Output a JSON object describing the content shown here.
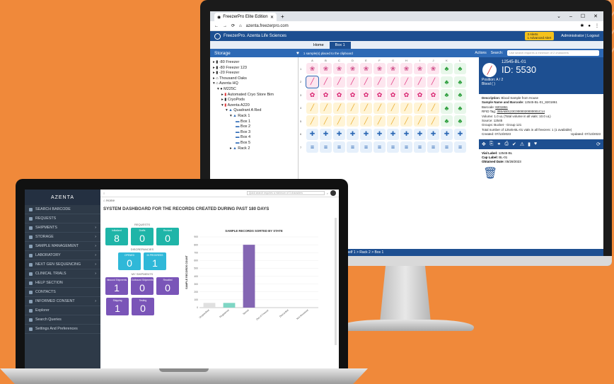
{
  "monitor": {
    "browser_tab": "FreezerPro Elite Edition",
    "url": "azenta.freezerpro.com",
    "app_title": "FreezerPro. Azenta Life Sciences",
    "alerts": [
      "3 Alerts",
      "1 Advanced Alert"
    ],
    "admin": "Administrator | Logout",
    "tabs": [
      "Home",
      "Box 1"
    ],
    "storage_label": "Storage",
    "clipboard_msg": "1 sample(s) placed to the clipboard",
    "actions_label": "Actions",
    "search_label": "Search:",
    "search_placeholder": "Use search requires a minimum of 2 characters",
    "tree": [
      "-80 Freezer",
      "-80 Freezer 123",
      "-20 Freezer",
      "Thousand Oaks",
      "Azenta HQ",
      "M225C",
      "Automated Cryo Store Bim",
      "CryoPods",
      "Azenta A220",
      "Quadrant A Red",
      "Rack 1",
      "Box 1",
      "Box 2",
      "Box 3",
      "Box 4",
      "Box 5",
      "Rack 2"
    ],
    "grid_cols": [
      "A",
      "B",
      "C",
      "D",
      "E",
      "F",
      "G",
      "H",
      "I",
      "J",
      "K",
      "L"
    ],
    "grid_rows": [
      "1",
      "2",
      "3",
      "4",
      "5",
      "6",
      "7"
    ],
    "detail": {
      "code": "12545-BL-01",
      "id": "ID: 5530",
      "position": "Position: A / 2",
      "type": "Blood ( )",
      "description": "Blood Sample from House",
      "sample_barcode": "12545-BL-01_8201861",
      "barcode": "8201861",
      "rfid": "355AB0123C0000020000001C14",
      "volume": "Volume: 1.0 uL (Total volume in all vials: 10.0 uL)",
      "source": "Source: 12545",
      "groups": "Groups: Bucket - Group 121",
      "total": "Total number of 12545-BL-01 vials in all freezers: 1 (1 available)",
      "created": "Created: 07/13/2023",
      "updated": "Updated: 07/13/2023",
      "vial_label": "12545-BL",
      "cap_label": "BL-01",
      "obtained": "05/28/2023"
    },
    "footer_breadcrumb": "Shelf 1 > Rack 2 > Box 1"
  },
  "laptop": {
    "brand": "AZENTA",
    "search_placeholder": "Quick search requires a minimum of 3 characters",
    "breadcrumb": "Home",
    "title": "SYSTEM DASHBOARD FOR THE RECORDS CREATED DURING PAST 180 DAYS",
    "nav": [
      "SEARCH BARCODE",
      "REQUESTS",
      "SHIPMENTS",
      "STORAGE",
      "SAMPLE MANAGEMENT",
      "LABORATORY",
      "NEXT GEN SEQUENCING",
      "CLINICAL TRIALS",
      "HELP SECTION",
      "CONTACTS",
      "INFORMED CONSENT",
      "Explorer",
      "Search Queries",
      "Settings And Preferences"
    ],
    "requests_label": "REQUESTS",
    "requests": [
      {
        "label": "Initialized",
        "value": "8",
        "color": "#1fb5a8"
      },
      {
        "label": "Drafts",
        "value": "0",
        "color": "#1fb5a8"
      },
      {
        "label": "Recived",
        "value": "0",
        "color": "#1fb5a8"
      }
    ],
    "discrepancies_label": "DISCREPANCIES",
    "discrepancies": [
      {
        "label": "OPENED",
        "value": "0",
        "color": "#2fb8d8"
      },
      {
        "label": "IN PROGRESS",
        "value": "1",
        "color": "#2fb8d8"
      }
    ],
    "shipments_label": "MY SHIPMENTS",
    "shipments": [
      {
        "label": "Inbound Shipments",
        "value": "1",
        "color": "#7a55b8"
      },
      {
        "label": "Outbound Shipments",
        "value": "0",
        "color": "#7a55b8"
      },
      {
        "label": "Recalled",
        "value": "0",
        "color": "#7a55b8"
      }
    ],
    "shipments2": [
      {
        "label": "Shipping",
        "value": "1",
        "color": "#7a55b8"
      },
      {
        "label": "Testing",
        "value": "0",
        "color": "#7a55b8"
      }
    ]
  },
  "chart_data": {
    "type": "bar",
    "title": "SAMPLE RECORDS SORTED BY STATE",
    "ylabel": "SAMPLE RECORDS COUNT",
    "categories": [
      "Unspecified",
      "Registered",
      "Stored",
      "Out of Freezer",
      "Discarded",
      "Not Received"
    ],
    "values": [
      60,
      60,
      800,
      0,
      0,
      0
    ],
    "colors": [
      "#e0e0e0",
      "#7fd6c4",
      "#8466b3",
      "#8466b3",
      "#8466b3",
      "#8466b3"
    ],
    "yticks": [
      0,
      100,
      200,
      300,
      400,
      500,
      600,
      700,
      800,
      900
    ],
    "ylim": [
      0,
      900
    ]
  }
}
